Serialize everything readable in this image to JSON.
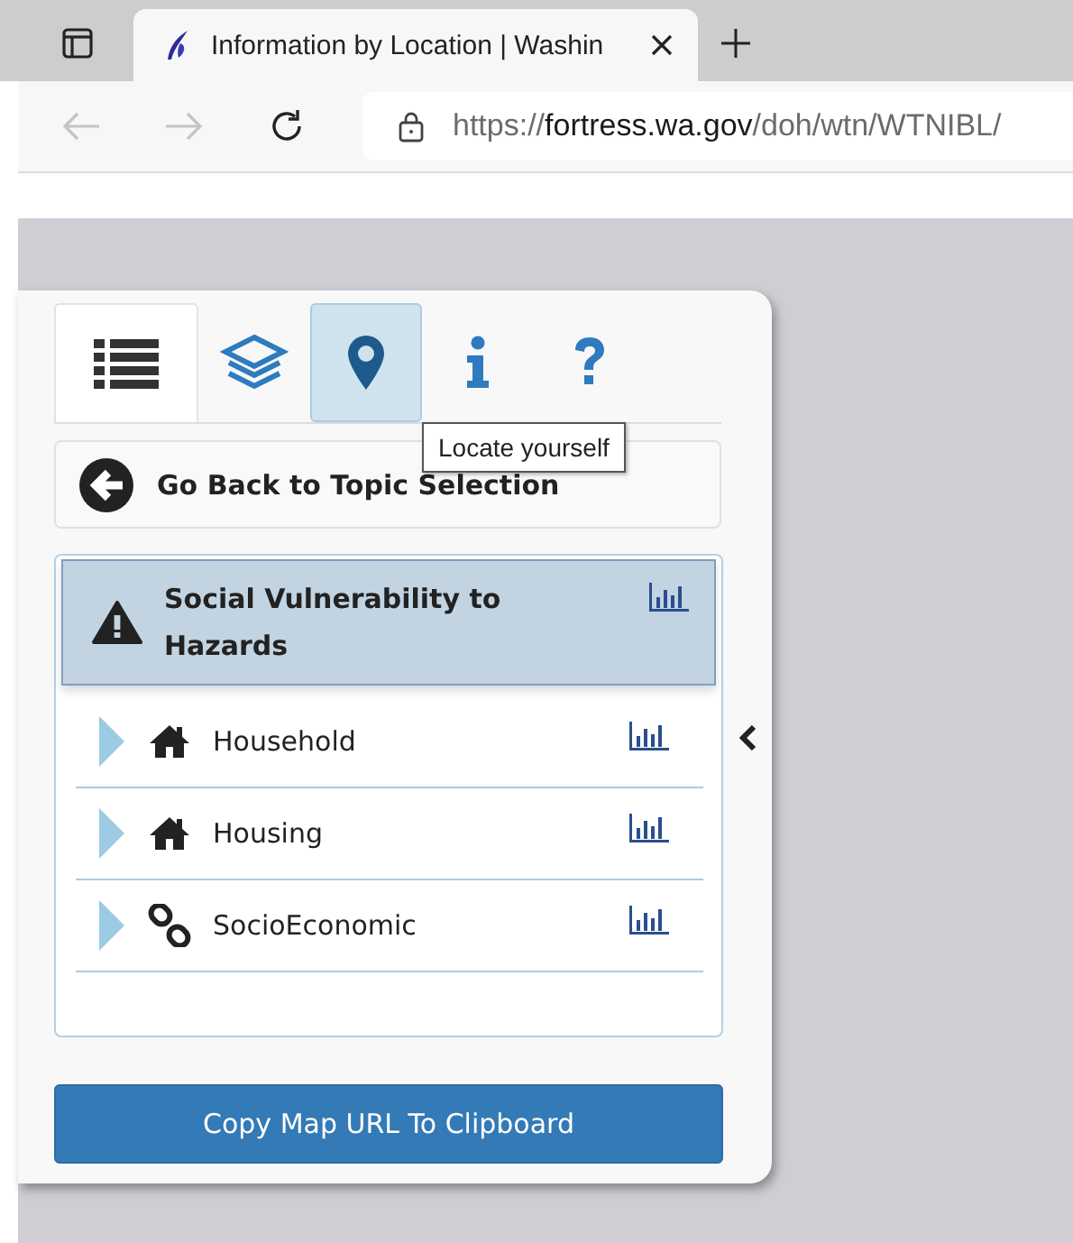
{
  "browser": {
    "tab_title": "Information by Location | Washin",
    "url_scheme": "https://",
    "url_host": "fortress.wa.gov",
    "url_path": "/doh/wtn/WTNIBL/"
  },
  "panel_tabs": [
    {
      "kind": "list",
      "selected": true,
      "hovered": false
    },
    {
      "kind": "layers",
      "selected": false,
      "hovered": false
    },
    {
      "kind": "locate",
      "selected": false,
      "hovered": true
    },
    {
      "kind": "info",
      "selected": false,
      "hovered": false
    },
    {
      "kind": "help",
      "selected": false,
      "hovered": false
    }
  ],
  "tooltip": "Locate yourself",
  "back_button": "Go Back to Topic Selection",
  "topic": {
    "title": "Social Vulnerability to Hazards",
    "selected": true
  },
  "categories": [
    {
      "kind": "house",
      "label": "Household",
      "expanded": false
    },
    {
      "kind": "house",
      "label": "Housing",
      "expanded": false
    },
    {
      "kind": "link",
      "label": "SocioEconomic",
      "expanded": false
    }
  ],
  "copy_button": "Copy Map URL To Clipboard"
}
